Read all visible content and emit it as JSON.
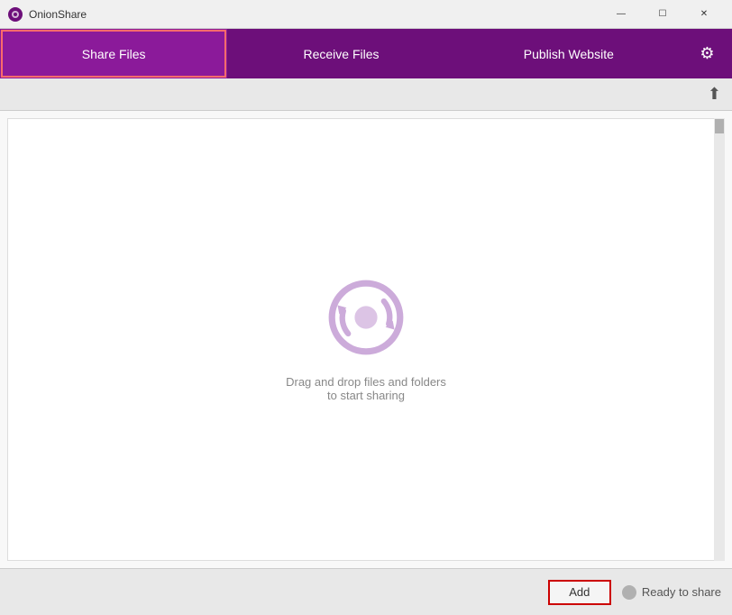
{
  "titleBar": {
    "appName": "OnionShare",
    "controls": {
      "minimize": "—",
      "maximize": "☐",
      "close": "✕"
    }
  },
  "nav": {
    "tabs": [
      {
        "id": "share-files",
        "label": "Share Files",
        "active": true
      },
      {
        "id": "receive-files",
        "label": "Receive Files",
        "active": false
      },
      {
        "id": "publish-website",
        "label": "Publish Website",
        "active": false
      }
    ],
    "settings_icon": "⚙"
  },
  "toolbar": {
    "upload_icon": "⬆"
  },
  "dropArea": {
    "line1": "Drag and drop files and folders",
    "line2": "to start sharing"
  },
  "bottomBar": {
    "add_button_label": "Add",
    "status_text": "Ready to share"
  }
}
